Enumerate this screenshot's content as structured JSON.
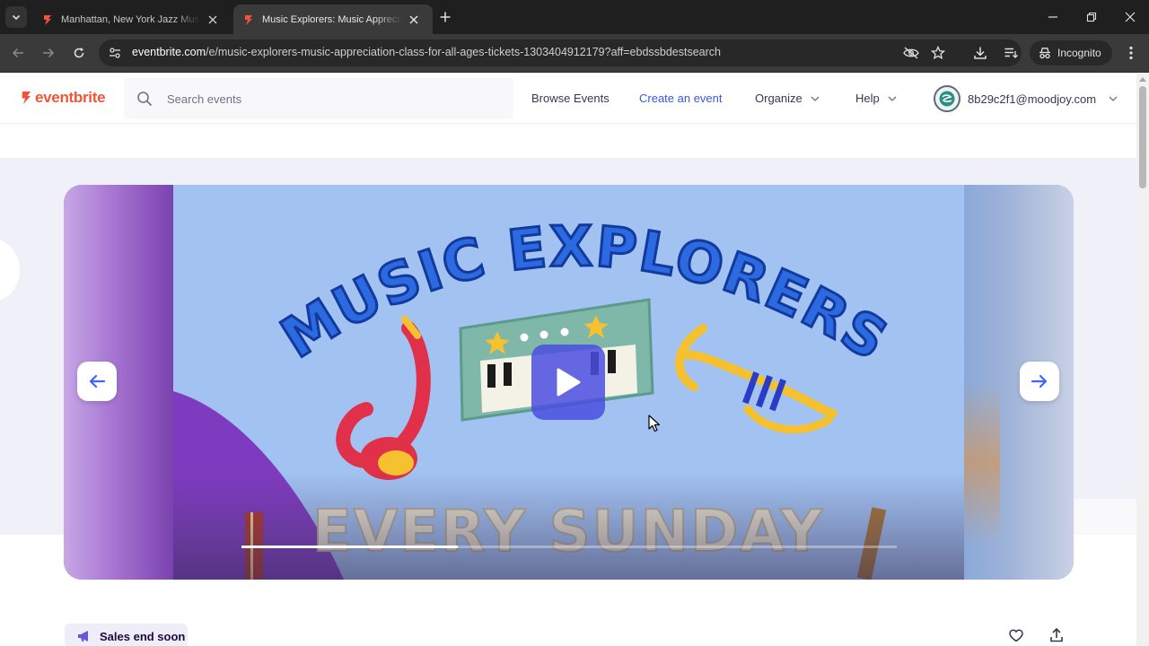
{
  "browser": {
    "tabs": [
      {
        "title": "Manhattan, New York Jazz Music",
        "active": false
      },
      {
        "title": "Music Explorers: Music Appreciation",
        "active": true
      }
    ],
    "url": {
      "host": "eventbrite.com",
      "path": "/e/music-explorers-music-appreciation-class-for-all-ages-tickets-1303404912179?aff=ebdssbdestsearch"
    },
    "incognito_label": "Incognito"
  },
  "site": {
    "logo": "eventbrite",
    "brand_color": "#f05537",
    "search": {
      "placeholder": "Search events",
      "value": ""
    },
    "nav": {
      "browse": "Browse Events",
      "create": "Create an event",
      "organize": "Organize",
      "help": "Help"
    },
    "account_email": "8b29c2f1@moodjoy.com"
  },
  "hero": {
    "slide_title": "MUSIC EXPLORERS",
    "slide_subtitle": "EVERY SUNDAY",
    "video_progress": 0.33,
    "controls": {
      "prev": "previous-slide",
      "next": "next-slide",
      "play": "play-video"
    }
  },
  "event": {
    "badge": "Sales end soon"
  },
  "colors": {
    "link_blue": "#3659e3",
    "play_button": "#4a4ee0",
    "text_dark": "#39364f"
  }
}
